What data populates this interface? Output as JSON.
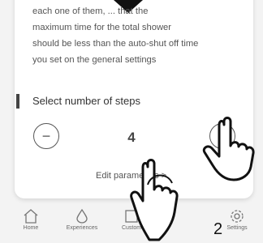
{
  "description": {
    "lines": [
      "each one of them, ... that the",
      "maximum time for the total shower",
      "should be less than the auto-shut off time",
      "you set on the general settings"
    ]
  },
  "steps": {
    "title": "Select number of steps",
    "value": "4",
    "decrement_symbol": "−",
    "increment_symbol": "+",
    "edit_label": "Edit parameters >"
  },
  "nav": {
    "items": [
      {
        "label": "Home",
        "icon": "home-icon"
      },
      {
        "label": "Experiences",
        "icon": "drop-icon"
      },
      {
        "label": "Custom",
        "icon": "square-icon"
      },
      {
        "label": "Settings",
        "icon": "gear-icon"
      }
    ]
  },
  "overlay": {
    "number": "2"
  },
  "colors": {
    "card": "#ffffff",
    "background": "#f3f3f3",
    "text": "#555555"
  }
}
